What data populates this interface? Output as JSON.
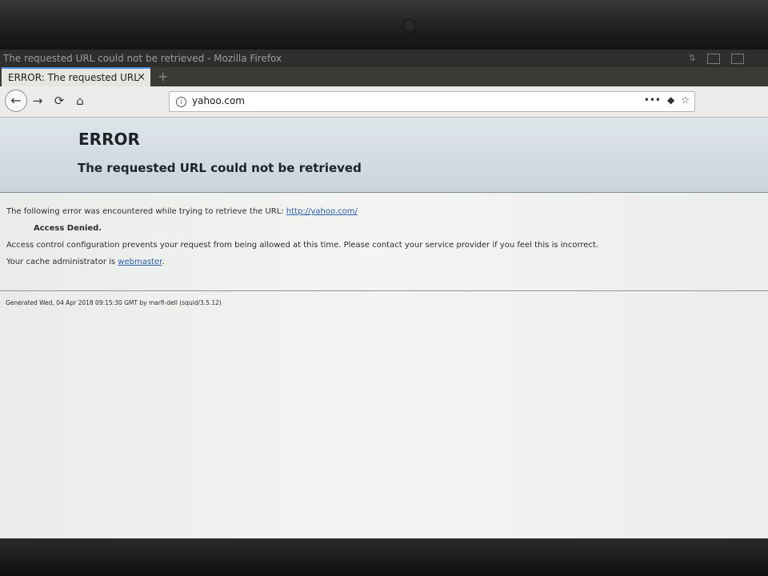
{
  "window": {
    "title": "The requested URL could not be retrieved - Mozilla Firefox"
  },
  "tab": {
    "title": "ERROR: The requested URL",
    "close_label": "×",
    "new_tab_label": "+"
  },
  "toolbar": {
    "back_label": "←",
    "forward_label": "→",
    "reload_label": "⟳",
    "home_label": "⌂",
    "url": "yahoo.com",
    "page_actions_label": "•••",
    "pocket_label": "◆",
    "bookmark_label": "☆"
  },
  "page": {
    "heading": "ERROR",
    "subheading": "The requested URL could not be retrieved",
    "line1_text": "The following error was encountered while trying to retrieve the URL: ",
    "line1_link": "http://yahoo.com/",
    "access_denied": "Access Denied.",
    "line3_text": "Access control configuration prevents your request from being allowed at this time. Please contact your service provider if you feel this is incorrect.",
    "line4_text": "Your cache administrator is ",
    "line4_link": "webmaster",
    "line4_suffix": ".",
    "footer": "Generated Wed, 04 Apr 2018 09:15:30 GMT by marfi-dell (squid/3.5.12)"
  },
  "colors": {
    "link": "#2a5db0",
    "header_bg": "#c9d4dc",
    "tab_accent": "#4a90d9"
  }
}
